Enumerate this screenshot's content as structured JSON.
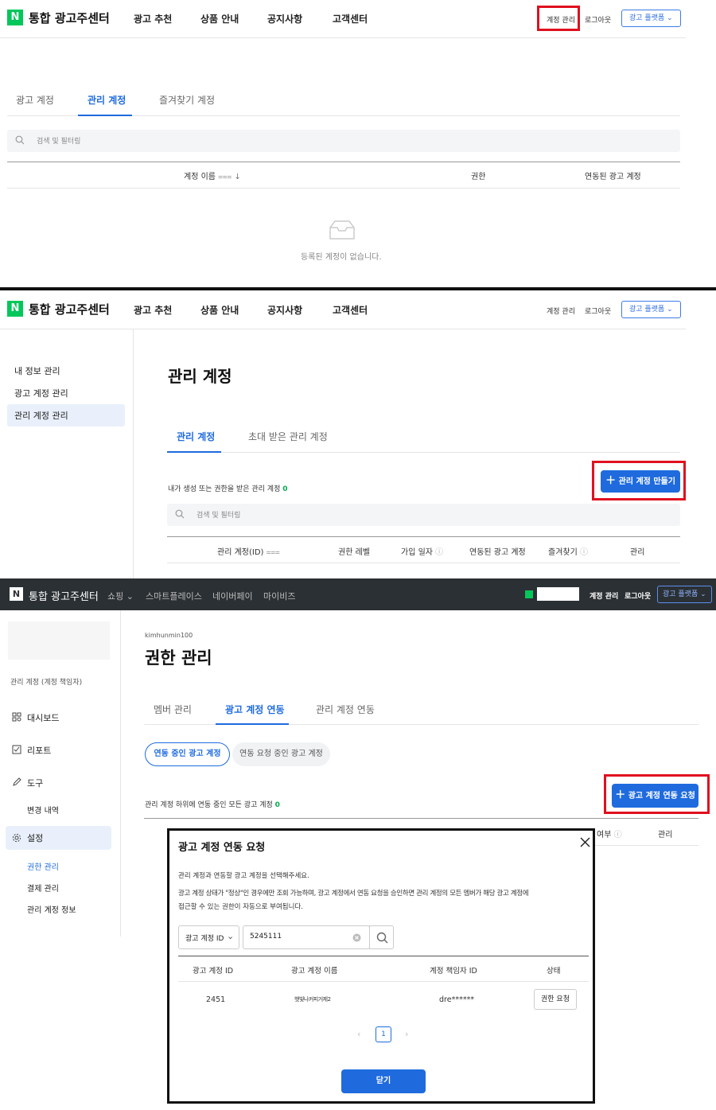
{
  "panel1": {
    "header": {
      "logo_letter": "N",
      "brand": "통합 광고주센터",
      "nav": [
        "광고 추천",
        "상품 안내",
        "공지사항",
        "고객센터"
      ],
      "account_link": "계정 관리",
      "logout_link": "로그아웃",
      "platform_button": "광고 플랫폼"
    },
    "tabs": [
      "광고 계정",
      "관리 계정",
      "즐겨찾기 계정"
    ],
    "search_placeholder": "검색 및 필터링",
    "columns": [
      "계정 이름",
      "권한",
      "연동된 광고 계정"
    ],
    "empty_message": "등록된 계정이 없습니다."
  },
  "panel2": {
    "header": {
      "logo_letter": "N",
      "brand": "통합 광고주센터",
      "nav": [
        "광고 추천",
        "상품 안내",
        "공지사항",
        "고객센터"
      ],
      "account_link": "계정 관리",
      "logout_link": "로그아웃",
      "platform_button": "광고 플랫폼"
    },
    "sidebar": [
      "내 정보 관리",
      "광고 계정 관리",
      "관리 계정 관리"
    ],
    "page_title": "관리 계정",
    "tabs": [
      "관리 계정",
      "초대 받은 관리 계정"
    ],
    "create_button": "관리 계정 만들기",
    "count_label": "내가 생성 또는 권한을 받은 관리 계정",
    "count_value": "0",
    "search_placeholder": "검색 및 필터링",
    "columns": [
      "관리 계정(ID)",
      "권한 레벨",
      "가입 일자",
      "연동된 광고 계정",
      "즐겨찾기",
      "관리"
    ]
  },
  "panel3": {
    "header": {
      "logo_letter": "N",
      "brand": "통합 광고주센터",
      "nav": [
        "쇼핑",
        "스마트플레이스",
        "네이버페이",
        "마이비즈"
      ],
      "account_link": "계정 관리",
      "logout_link": "로그아웃",
      "platform_button": "광고 플랫폼"
    },
    "sidebar": {
      "role": "관리 계정 (계정 책임자)",
      "items": [
        "대시보드",
        "리포트",
        "도구"
      ],
      "tool_sub": [
        "변경 내역"
      ],
      "settings": "설정",
      "settings_sub": [
        "권한 관리",
        "결제 관리",
        "관리 계정 정보"
      ]
    },
    "user_id": "kimhunmin100",
    "page_title": "권한 관리",
    "tabs": [
      "멤버 관리",
      "광고 계정 연동",
      "관리 계정 연동"
    ],
    "pills": [
      "연동 중인 광고 계정",
      "연동 요청 중인 광고 계정"
    ],
    "request_button": "광고 계정 연동 요청",
    "count_label": "관리 계정 하위에 연동 중인 모든 광고 계정",
    "count_value": "0",
    "columns_partial": [
      "여부",
      "관리"
    ]
  },
  "modal": {
    "title": "광고 계정 연동 요청",
    "desc1": "관리 계정과 연동할 광고 계정을 선택해주세요.",
    "desc2": "광고 계정 상태가 \"정상\"인 경우에만 조회 가능하며, 광고 계정에서 연동 요청을 승인하면 관리 계정의 모든 멤버가 해당 광고 계정에",
    "desc3": "접근할 수 있는 권한이 자동으로 부여됩니다.",
    "select_value": "광고 계정 ID",
    "search_value": "5245111",
    "columns": [
      "광고 계정 ID",
      "광고 계정 이름",
      "계정 책임자 ID",
      "상태"
    ],
    "row": {
      "id": "2451",
      "name": "햇빛나커피거제2",
      "owner": "dre******",
      "action": "권한 요청"
    },
    "page": "1",
    "close_button": "닫기"
  }
}
